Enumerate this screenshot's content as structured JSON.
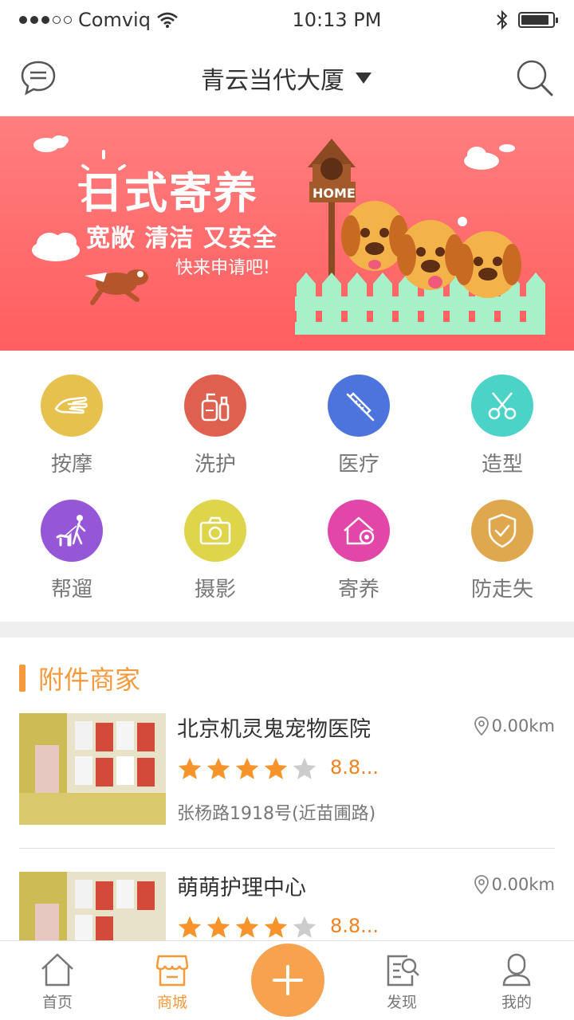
{
  "status_bar": {
    "carrier": "Comviq",
    "time": "10:13 PM",
    "battery_level": 0.9
  },
  "header": {
    "location": "青云当代大厦",
    "icons": [
      "chat-icon",
      "search-icon"
    ]
  },
  "banner": {
    "title": "日式寄养",
    "subtitle": "宽敞  清洁  又安全",
    "cta": "快来申请吧!",
    "house_sign": "HOME",
    "bg_color": "#ff6668"
  },
  "categories": [
    {
      "label": "按摩",
      "icon": "massage-hand-icon",
      "color": "#e7c14d"
    },
    {
      "label": "洗护",
      "icon": "bath-care-icon",
      "color": "#e0604f"
    },
    {
      "label": "医疗",
      "icon": "syringe-icon",
      "color": "#4d74dd"
    },
    {
      "label": "造型",
      "icon": "scissors-icon",
      "color": "#4cd3c7"
    },
    {
      "label": "帮遛",
      "icon": "dog-walk-icon",
      "color": "#9656d8"
    },
    {
      "label": "摄影",
      "icon": "camera-icon",
      "color": "#dfd54a"
    },
    {
      "label": "寄养",
      "icon": "pet-home-icon",
      "color": "#e346a9"
    },
    {
      "label": "防走失",
      "icon": "shield-check-icon",
      "color": "#e0a84e"
    }
  ],
  "section": {
    "title": "附件商家",
    "accent": "#f59a3c"
  },
  "merchants": [
    {
      "name": "北京机灵鬼宠物医院",
      "distance": "0.00km",
      "stars": 4,
      "rating": "8.8...",
      "address": "张杨路1918号(近苗圃路)"
    },
    {
      "name": "萌萌护理中心",
      "distance": "0.00km",
      "stars": 4,
      "rating": "8.8...",
      "address": ""
    }
  ],
  "tabbar": {
    "tabs": [
      {
        "label": "首页",
        "icon": "home-icon",
        "active": false
      },
      {
        "label": "商城",
        "icon": "store-icon",
        "active": true
      },
      {
        "label": "发现",
        "icon": "discover-icon",
        "active": false
      },
      {
        "label": "我的",
        "icon": "profile-icon",
        "active": false
      }
    ],
    "center_icon": "plus-icon"
  }
}
